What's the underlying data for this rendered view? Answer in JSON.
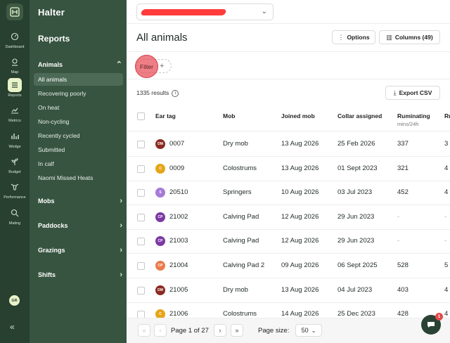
{
  "app": {
    "brand": "Halter"
  },
  "rail": {
    "items": [
      {
        "label": "Dashboard",
        "icon": "gauge-icon"
      },
      {
        "label": "Map",
        "icon": "map-pin-icon"
      },
      {
        "label": "Reports",
        "icon": "list-icon"
      },
      {
        "label": "Metrics",
        "icon": "line-chart-icon"
      },
      {
        "label": "Wedge",
        "icon": "bar-chart-icon"
      },
      {
        "label": "Budget",
        "icon": "sprout-icon"
      },
      {
        "label": "Performance",
        "icon": "cow-icon"
      },
      {
        "label": "Mating",
        "icon": "search-heart-icon"
      }
    ],
    "avatar": "GR",
    "collapse": "«"
  },
  "menu": {
    "title": "Reports",
    "animals_label": "Animals",
    "animals_items": [
      "All animals",
      "Recovering poorly",
      "On heat",
      "Non-cycling",
      "Recently cycled",
      "Submitted",
      "In calf",
      "Naomi Missed Heats"
    ],
    "groups": [
      "Mobs",
      "Paddocks",
      "Grazings",
      "Shifts"
    ]
  },
  "header": {
    "title": "All animals",
    "options_label": "Options",
    "columns_label": "Columns (49)",
    "filter_label": "Filter",
    "filter_add": "+",
    "results": "1335 results",
    "export_label": "Export CSV"
  },
  "table": {
    "columns": [
      "Ear tag",
      "Mob",
      "Joined mob",
      "Collar assigned",
      "Ruminating",
      "Ru"
    ],
    "ruminating_unit": "mins/24h",
    "rows": [
      {
        "badge": "DM",
        "color": "#8b2b22",
        "tag": "0007",
        "mob": "Dry mob",
        "joined": "13 Aug 2026",
        "collar": "25 Feb 2026",
        "rum": "337",
        "extra": "3"
      },
      {
        "badge": "C",
        "color": "#e6a517",
        "tag": "0009",
        "mob": "Colostrums",
        "joined": "13 Aug 2026",
        "collar": "01 Sept 2023",
        "rum": "321",
        "extra": "4"
      },
      {
        "badge": "S",
        "color": "#a57ad8",
        "tag": "20510",
        "mob": "Springers",
        "joined": "10 Aug 2026",
        "collar": "03 Jul 2023",
        "rum": "452",
        "extra": "4"
      },
      {
        "badge": "CP",
        "color": "#7b3aa3",
        "tag": "21002",
        "mob": "Calving Pad",
        "joined": "12 Aug 2026",
        "collar": "29 Jun 2023",
        "rum": "-",
        "extra": "-"
      },
      {
        "badge": "CP",
        "color": "#7b3aa3",
        "tag": "21003",
        "mob": "Calving Pad",
        "joined": "12 Aug 2026",
        "collar": "29 Jun 2023",
        "rum": "-",
        "extra": "-"
      },
      {
        "badge": "CP",
        "color": "#ea7b4b",
        "tag": "21004",
        "mob": "Calving Pad 2",
        "joined": "09 Aug 2026",
        "collar": "06 Sept 2025",
        "rum": "528",
        "extra": "5"
      },
      {
        "badge": "DM",
        "color": "#8b2b22",
        "tag": "21005",
        "mob": "Dry mob",
        "joined": "13 Aug 2026",
        "collar": "04 Jul 2023",
        "rum": "403",
        "extra": "4"
      },
      {
        "badge": "C",
        "color": "#e6a517",
        "tag": "21006",
        "mob": "Colostrums",
        "joined": "14 Aug 2026",
        "collar": "25 Dec 2023",
        "rum": "428",
        "extra": "4"
      }
    ]
  },
  "pager": {
    "first": "«",
    "prev": "‹",
    "next": "›",
    "last": "»",
    "page_text": "Page 1 of 27",
    "size_label": "Page size:",
    "size_value": "50",
    "chat_badge": "1"
  }
}
